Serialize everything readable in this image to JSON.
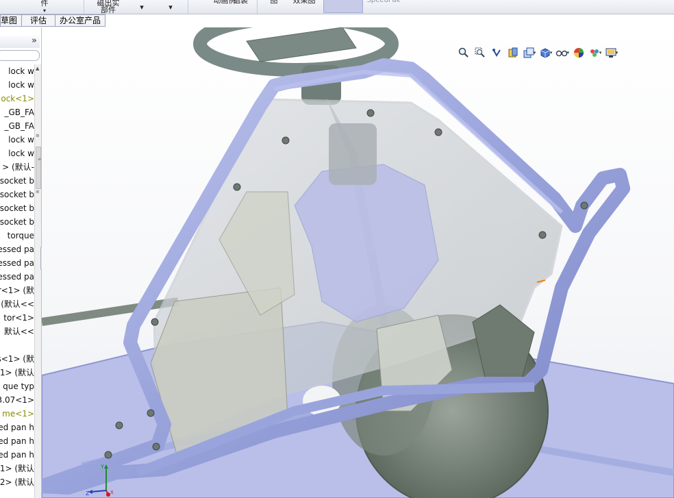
{
  "ribbon": {
    "items": [
      {
        "label": "件"
      },
      {
        "label": "磁出实\n部件"
      },
      {
        "label": "动画例"
      },
      {
        "label": "组装"
      },
      {
        "label": "图"
      },
      {
        "label": "效果图"
      },
      {
        "label": "SpeedPak"
      }
    ]
  },
  "tabs": [
    {
      "label": "草图"
    },
    {
      "label": "评估"
    },
    {
      "label": "办公室产品"
    }
  ],
  "panel": {
    "collapse_glyph": "»",
    "tree": [
      {
        "label": "lock w",
        "highlight": false
      },
      {
        "label": "lock w",
        "highlight": false
      },
      {
        "label": "ock<1>",
        "highlight": true
      },
      {
        "label": "_GB_FA",
        "highlight": false
      },
      {
        "label": "_GB_FA",
        "highlight": false
      },
      {
        "label": "lock w",
        "highlight": false
      },
      {
        "label": "lock w",
        "highlight": false
      },
      {
        "label": "> (默认-",
        "highlight": false
      },
      {
        "label": "socket b",
        "highlight": false
      },
      {
        "label": "socket b",
        "highlight": false
      },
      {
        "label": "socket b",
        "highlight": false
      },
      {
        "label": "socket b",
        "highlight": false
      },
      {
        "label": "torque",
        "highlight": false
      },
      {
        "label": "essed pa",
        "highlight": false
      },
      {
        "label": "essed pa",
        "highlight": false
      },
      {
        "label": "essed pa",
        "highlight": false
      },
      {
        "label": "er<1> (默",
        "highlight": false
      },
      {
        "label": "(默认<<",
        "highlight": false
      },
      {
        "label": "tor<1>",
        "highlight": false
      },
      {
        "label": "默认<<",
        "highlight": false
      },
      {
        "label": "",
        "highlight": false
      },
      {
        "label": "s<1> (默",
        "highlight": false
      },
      {
        "label": "1> (默认",
        "highlight": false
      },
      {
        "label": "que typ",
        "highlight": false
      },
      {
        "label": "3.07<1>",
        "highlight": false
      },
      {
        "label": "me<1>",
        "highlight": true
      },
      {
        "label": "ed pan h",
        "highlight": false
      },
      {
        "label": "ed pan h",
        "highlight": false
      },
      {
        "label": "ed pan h",
        "highlight": false
      },
      {
        "label": "1> (默认",
        "highlight": false
      },
      {
        "label": "2> (默认",
        "highlight": false
      }
    ]
  },
  "view_toolbar": {
    "icons": [
      "zoom-to-fit-icon",
      "zoom-area-icon",
      "previous-view-icon",
      "section-view-icon",
      "view-orientation-icon",
      "display-style-icon",
      "hide-show-items-icon",
      "edit-appearance-icon",
      "apply-scene-icon",
      "view-settings-icon"
    ]
  },
  "triad": {
    "y": "Y",
    "z": "Z",
    "x": "X"
  },
  "colors": {
    "frame": "#9ea8dd",
    "panel_bg": "#ffffff",
    "highlight": "#8a8a00",
    "tire": "#6f7a70"
  }
}
